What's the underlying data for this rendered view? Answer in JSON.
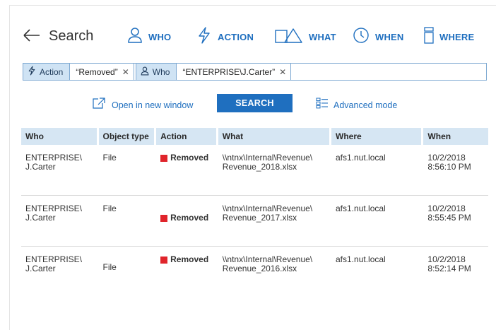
{
  "header": {
    "title": "Search",
    "nav": [
      {
        "label": "WHO",
        "icon": "person-icon"
      },
      {
        "label": "ACTION",
        "icon": "lightning-icon"
      },
      {
        "label": "WHAT",
        "icon": "shapes-icon"
      },
      {
        "label": "WHEN",
        "icon": "clock-icon"
      },
      {
        "label": "WHERE",
        "icon": "server-icon"
      }
    ]
  },
  "filters": [
    {
      "category": "Action",
      "value": "“Removed”"
    },
    {
      "category": "Who",
      "value": "“ENTERPRISE\\J.Carter”"
    }
  ],
  "actions": {
    "open_window": "Open in new window",
    "search": "SEARCH",
    "advanced": "Advanced mode"
  },
  "table": {
    "headers": [
      "Who",
      "Object type",
      "Action",
      "What",
      "Where",
      "When"
    ],
    "rows": [
      {
        "who1": "ENTERPRISE\\",
        "who2": "J.Carter",
        "type": "File",
        "action": "Removed",
        "what1": "\\\\ntnx\\Internal\\Revenue\\",
        "what2": "Revenue_2018.xlsx",
        "where": "afs1.nut.local",
        "date": "10/2/2018",
        "time": "8:56:10 PM"
      },
      {
        "who1": "ENTERPRISE\\",
        "who2": "J.Carter",
        "type": "File",
        "action": "Removed",
        "what1": "\\\\ntnx\\Internal\\Revenue\\",
        "what2": "Revenue_2017.xlsx",
        "where": "afs1.nut.local",
        "date": "10/2/2018",
        "time": "8:55:45 PM"
      },
      {
        "who1": "ENTERPRISE\\",
        "who2": "J.Carter",
        "type": "File",
        "action": "Removed",
        "what1": "\\\\ntnx\\Internal\\Revenue\\",
        "what2": "Revenue_2016.xlsx",
        "where": "afs1.nut.local",
        "date": "10/2/2018",
        "time": "8:52:14 PM"
      }
    ]
  },
  "colors": {
    "accent": "#1f6fbf",
    "header_bg": "#d6e6f3",
    "removed": "#e0242b"
  }
}
